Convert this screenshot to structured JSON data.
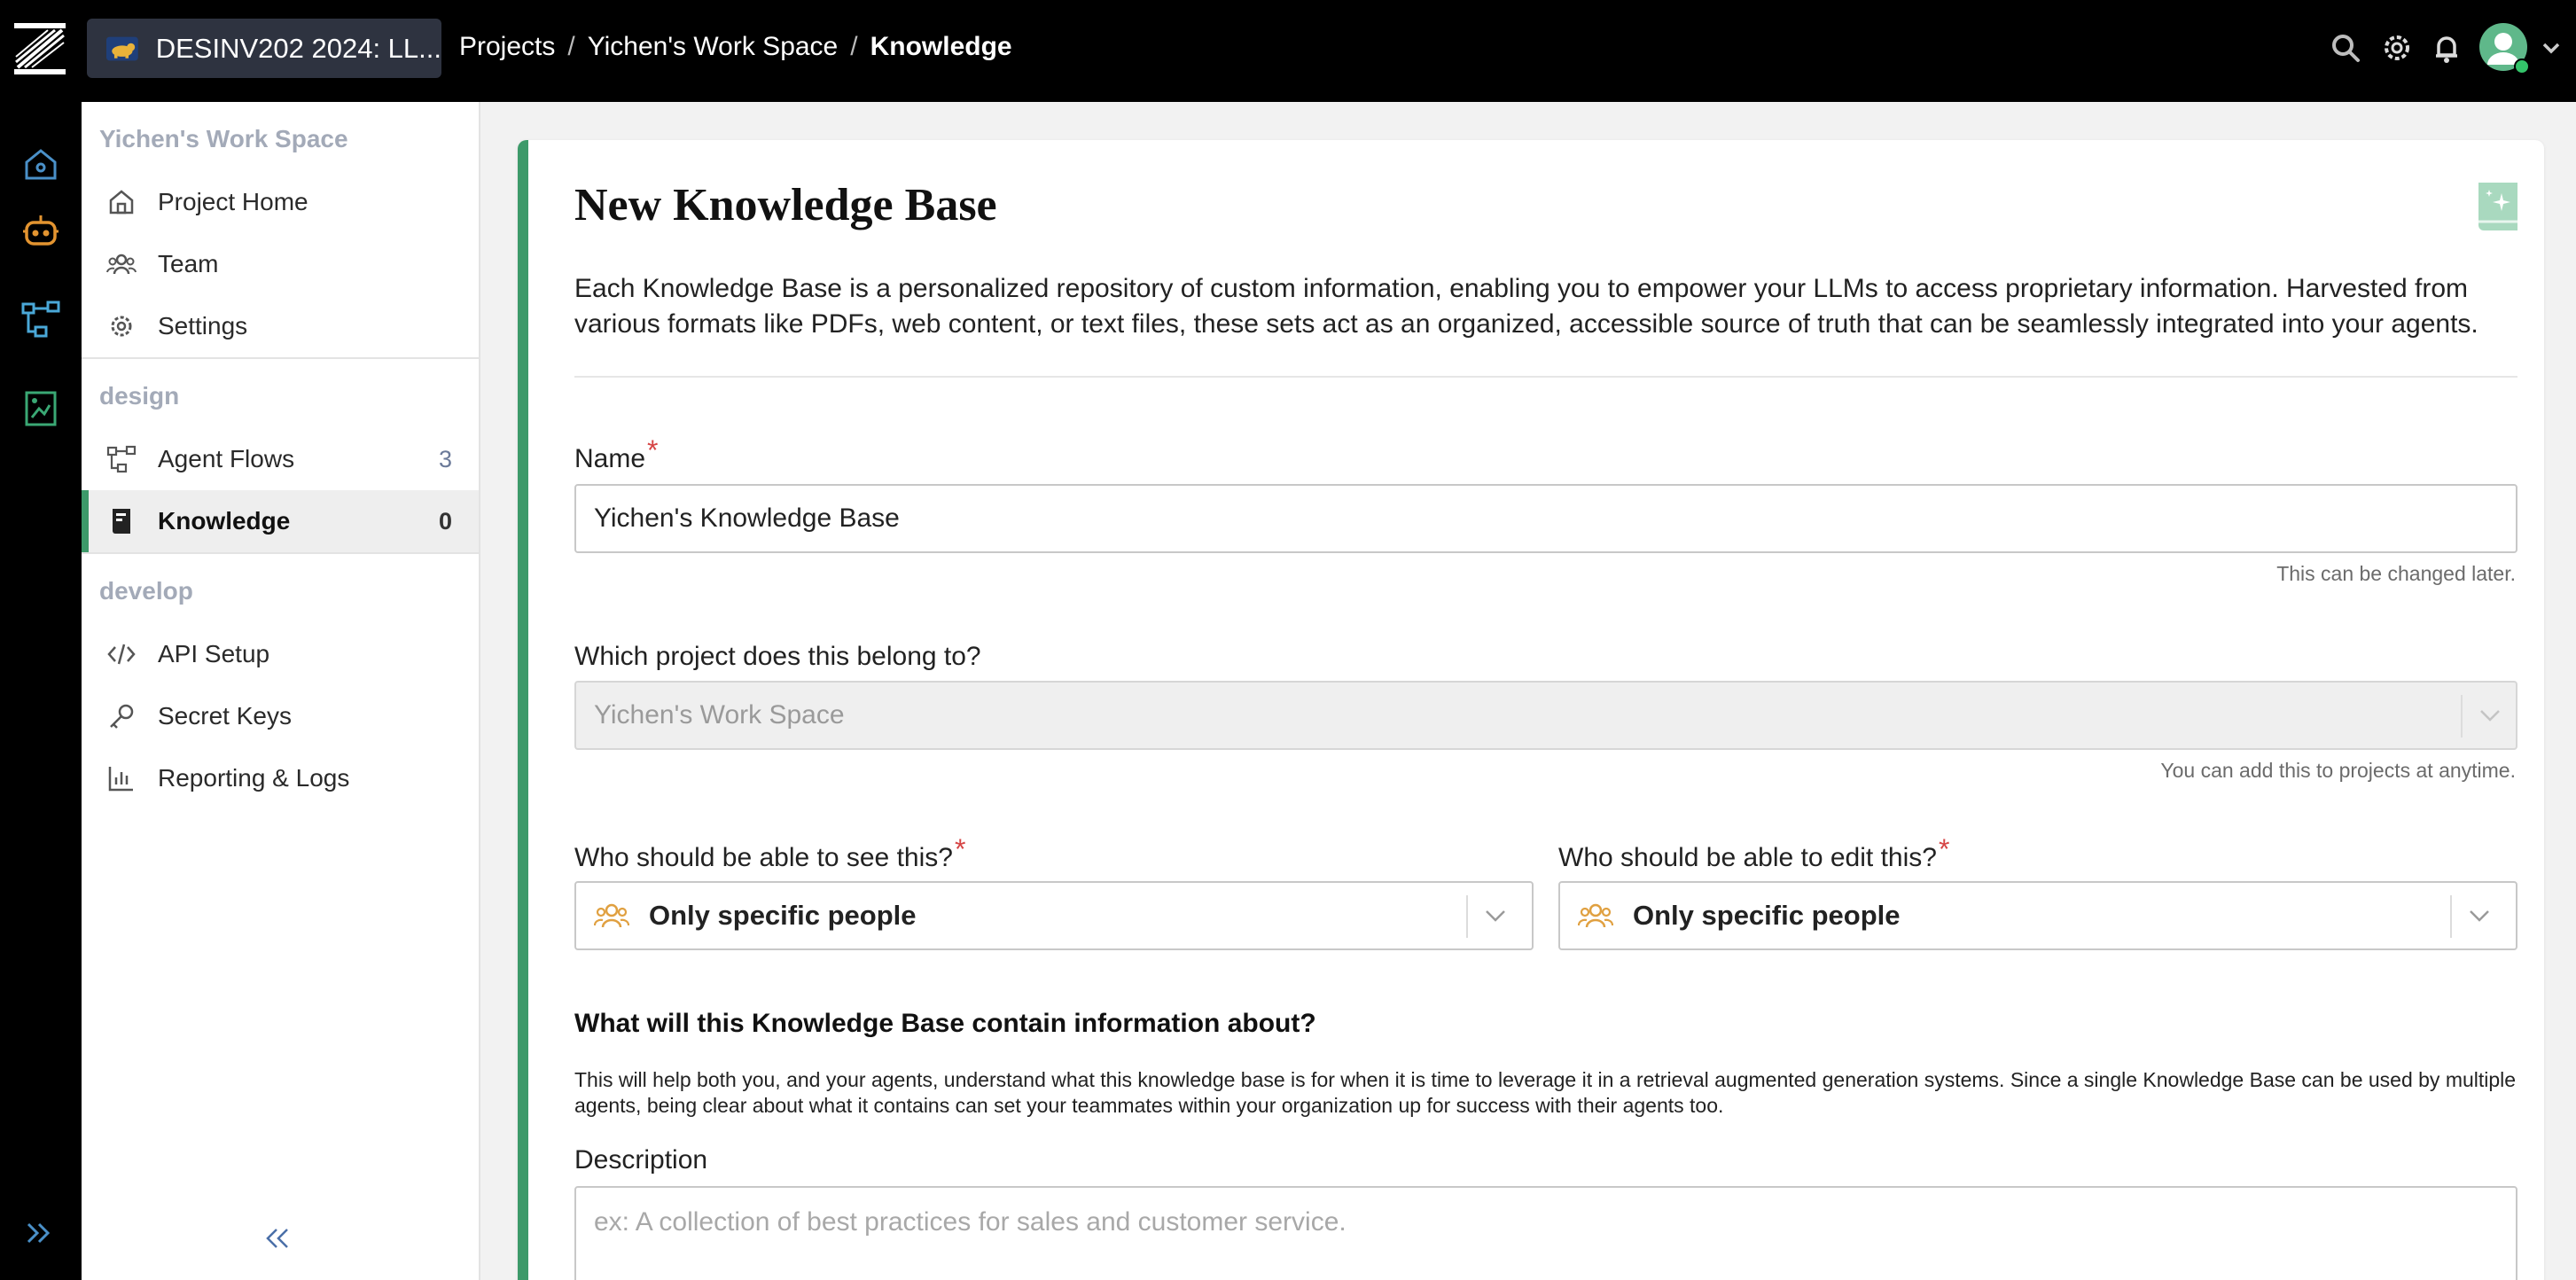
{
  "header": {
    "project_name": "DESINV202 2024: LL...",
    "breadcrumb": [
      "Projects",
      "Yichen's Work Space",
      "Knowledge"
    ],
    "breadcrumb_sep": "/",
    "icons": [
      "search-icon",
      "gear-icon",
      "bell-icon",
      "avatar",
      "chevron-down-icon"
    ]
  },
  "rail": {
    "icons": [
      "home-icon",
      "robot-icon",
      "flow-icon",
      "knowledge-icon",
      "expand-icon"
    ]
  },
  "sidebar": {
    "workspace_heading": "Yichen's Work Space",
    "workspace_items": [
      {
        "label": "Project Home",
        "icon": "home-icon"
      },
      {
        "label": "Team",
        "icon": "team-icon"
      },
      {
        "label": "Settings",
        "icon": "gear-icon"
      }
    ],
    "design_heading": "design",
    "design_items": [
      {
        "label": "Agent Flows",
        "icon": "flow-icon",
        "count": "3"
      },
      {
        "label": "Knowledge",
        "icon": "book-icon",
        "count": "0",
        "active": true
      }
    ],
    "develop_heading": "develop",
    "develop_items": [
      {
        "label": "API Setup",
        "icon": "code-icon"
      },
      {
        "label": "Secret Keys",
        "icon": "key-icon"
      },
      {
        "label": "Reporting & Logs",
        "icon": "chart-icon"
      }
    ]
  },
  "form": {
    "title": "New Knowledge Base",
    "intro": "Each Knowledge Base is a personalized repository of custom information, enabling you to empower your LLMs to access proprietary information. Harvested from various formats like PDFs, web content, or text files, these sets act as an organized, accessible source of truth that can be seamlessly integrated into your agents.",
    "name_label": "Name",
    "name_value": "Yichen's Knowledge Base",
    "name_help": "This can be changed later.",
    "project_label": "Which project does this belong to?",
    "project_value": "Yichen's Work Space",
    "project_help": "You can add this to projects at anytime.",
    "see_label": "Who should be able to see this?",
    "see_value": "Only specific people",
    "edit_label": "Who should be able to edit this?",
    "edit_value": "Only specific people",
    "contain_title": "What will this Knowledge Base contain information about?",
    "contain_desc": "This will help both you, and your agents, understand what this knowledge base is for when it is time to leverage it in a retrieval augmented generation systems. Since a single Knowledge Base can be used by multiple agents, being clear about what it contains can set your teammates within your organization up for success with their agents too.",
    "description_label": "Description",
    "description_placeholder": "ex: A collection of best practices for sales and customer service.",
    "required_mark": "*"
  },
  "colors": {
    "accent": "#3d9a6a",
    "required": "#d64545",
    "topbar": "#000000"
  }
}
